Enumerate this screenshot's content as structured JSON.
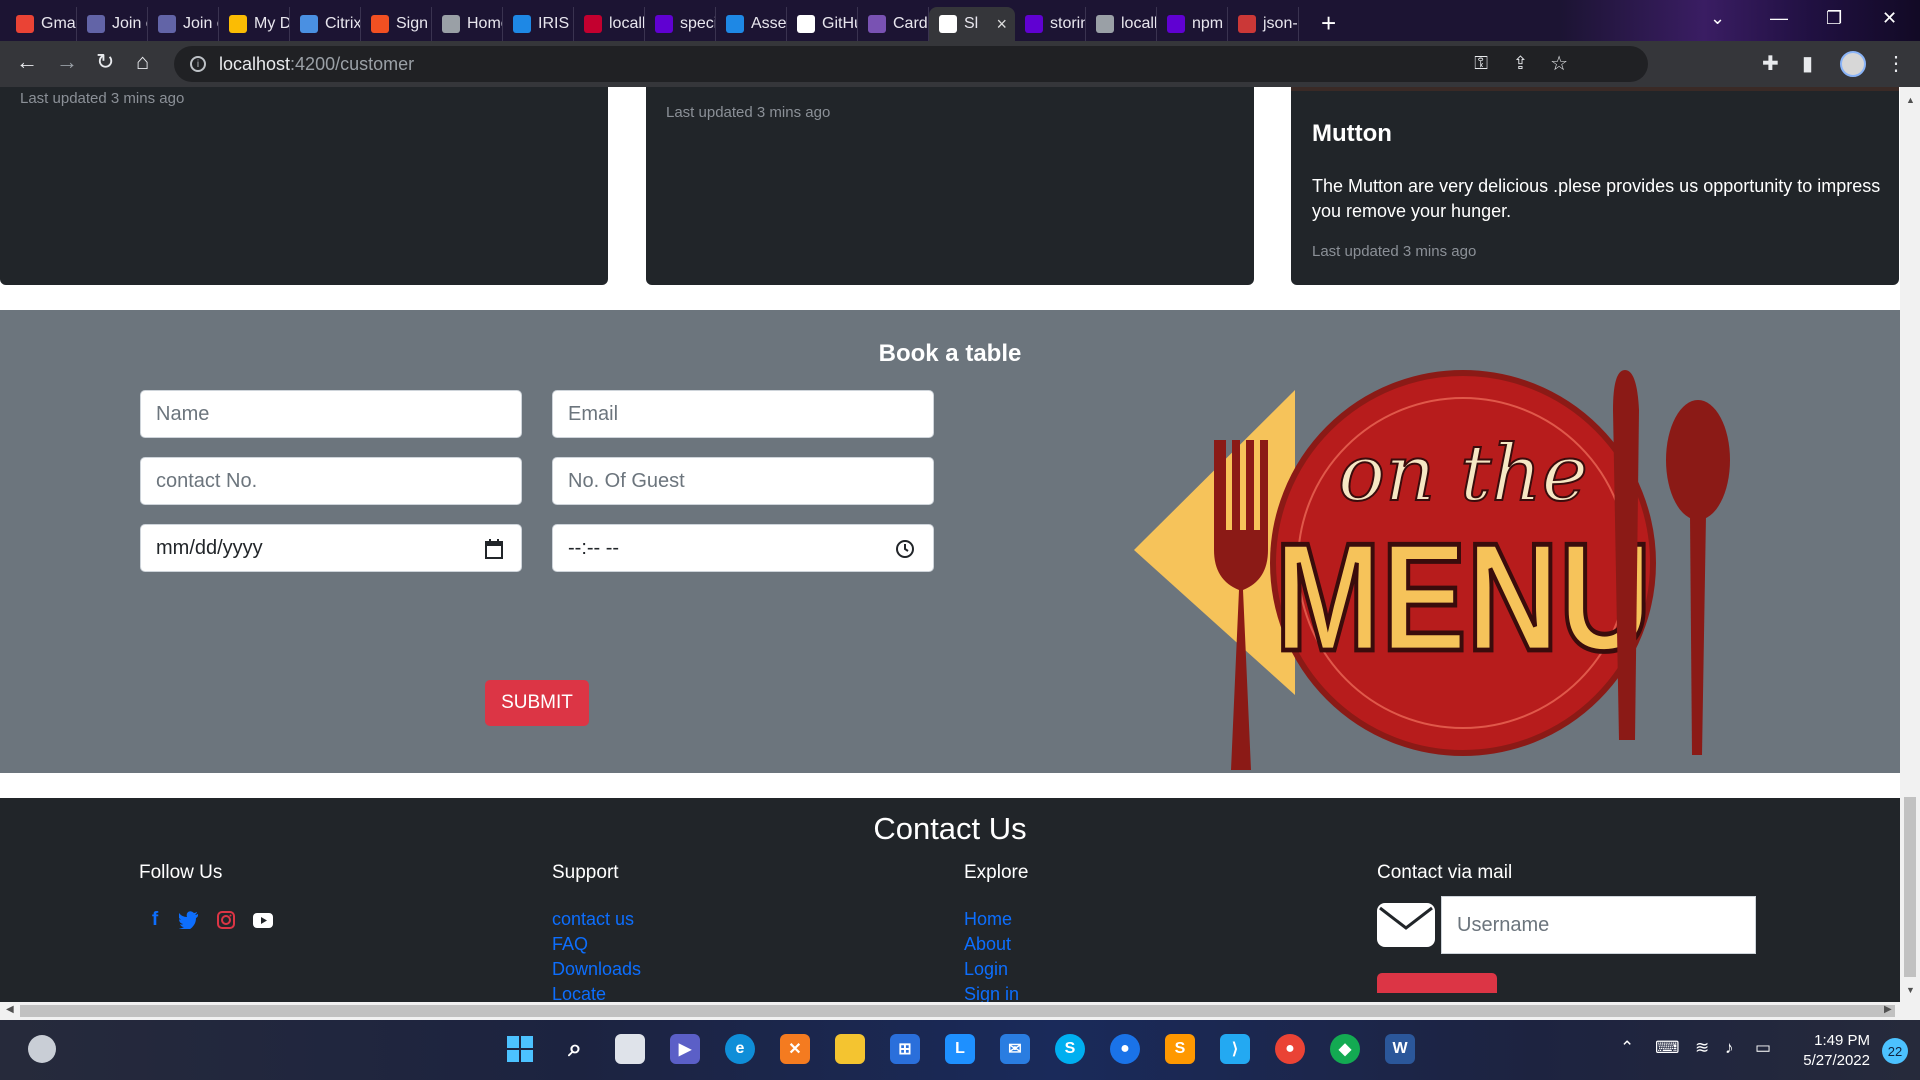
{
  "browser": {
    "tabs": [
      {
        "label": "Gmail",
        "icon": "gmail-icon",
        "color": "#ea4335"
      },
      {
        "label": "Join c",
        "icon": "teams-icon",
        "color": "#6264a7"
      },
      {
        "label": "Join c",
        "icon": "teams-icon",
        "color": "#6264a7"
      },
      {
        "label": "My Di",
        "icon": "google-drive-icon",
        "color": "#fbbc04"
      },
      {
        "label": "Citrix",
        "icon": "citrix-icon",
        "color": "#4a90e2"
      },
      {
        "label": "Sign i",
        "icon": "microsoft-icon",
        "color": "#f25022"
      },
      {
        "label": "Home",
        "icon": "globe-icon",
        "color": "#9aa0a6"
      },
      {
        "label": "IRIS |",
        "icon": "iris-icon",
        "color": "#1e88e5"
      },
      {
        "label": "localh",
        "icon": "angular-icon",
        "color": "#c3002f"
      },
      {
        "label": "specia",
        "icon": "yahoo-icon",
        "color": "#6001d2"
      },
      {
        "label": "Asses",
        "icon": "iris-icon",
        "color": "#1e88e5"
      },
      {
        "label": "GitHu",
        "icon": "github-icon",
        "color": "#ffffff"
      },
      {
        "label": "Cards",
        "icon": "bootstrap-icon",
        "color": "#7952b3"
      },
      {
        "label": "Sl",
        "icon": "angular-a-icon",
        "color": "#ffffff",
        "active": true
      },
      {
        "label": "storin",
        "icon": "yahoo-icon",
        "color": "#6001d2"
      },
      {
        "label": "localh",
        "icon": "doc-icon",
        "color": "#9aa0a6"
      },
      {
        "label": "npm",
        "icon": "yahoo-icon",
        "color": "#6001d2"
      },
      {
        "label": "json-",
        "icon": "npm-icon",
        "color": "#cb3837"
      }
    ],
    "url_host": "localhost",
    "url_path": ":4200/customer"
  },
  "cards": [
    {
      "updated": "Last updated 3 mins ago"
    },
    {
      "updated": "Last updated 3 mins ago"
    },
    {
      "title": "Mutton",
      "text": "The Mutton are very delicious .plese provides us opportunity to impress you remove your hunger.",
      "updated": "Last updated 3 mins ago"
    }
  ],
  "booking": {
    "heading": "Book a table",
    "name_placeholder": "Name",
    "email_placeholder": "Email",
    "contact_placeholder": "contact No.",
    "guests_placeholder": "No. Of Guest",
    "date_value": "mm/dd/yyyy",
    "time_value": "--:-- --",
    "submit_label": "SUBMIT"
  },
  "menu_logo": {
    "line1": "on the",
    "line2": "MENU"
  },
  "footer": {
    "heading": "Contact Us",
    "follow_us": "Follow Us",
    "support": {
      "heading": "Support",
      "links": [
        "contact us",
        "FAQ",
        "Downloads",
        "Locate"
      ]
    },
    "explore": {
      "heading": "Explore",
      "links": [
        "Home",
        "About",
        "Login",
        "Sign in"
      ]
    },
    "contact_mail": {
      "heading": "Contact via mail",
      "placeholder": "Username"
    }
  },
  "taskbar": {
    "time": "1:49 PM",
    "date": "5/27/2022",
    "notifications": "22"
  },
  "colors": {
    "accent_red": "#dc3545",
    "link_blue": "#0d6efd",
    "card_dark": "#212529",
    "section_gray": "#6c757d"
  }
}
